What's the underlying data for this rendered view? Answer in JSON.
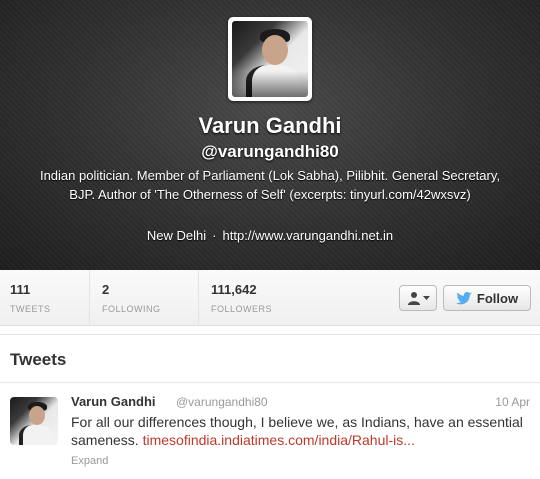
{
  "profile": {
    "name": "Varun Gandhi",
    "handle": "@varungandhi80",
    "bio": "Indian politician. Member of Parliament (Lok Sabha), Pilibhit. General Secretary, BJP. Author of 'The Otherness of Self' (excerpts: tinyurl.com/42wxsvz)",
    "location": "New Delhi",
    "separator": "·",
    "website": "http://www.varungandhi.net.in"
  },
  "stats": {
    "tweets": {
      "value": "111",
      "label": "TWEETS"
    },
    "following": {
      "value": "2",
      "label": "FOLLOWING"
    },
    "followers": {
      "value": "111,642",
      "label": "FOLLOWERS"
    }
  },
  "actions": {
    "follow_label": "Follow",
    "user_menu_icon": "person-dropdown-icon",
    "follow_icon": "twitter-bird-icon"
  },
  "tweets": {
    "title": "Tweets",
    "items": [
      {
        "name": "Varun Gandhi",
        "handle": "@varungandhi80",
        "date": "10 Apr",
        "text_before": "For all our differences though, I believe we, as Indians, have an essential sameness. ",
        "link": "timesofindia.indiatimes.com/india/Rahul-is...",
        "expand": "Expand"
      }
    ]
  },
  "colors": {
    "header_bg": "#2f2f2f",
    "link": "#c0392b",
    "follow_bird": "#55acee"
  }
}
